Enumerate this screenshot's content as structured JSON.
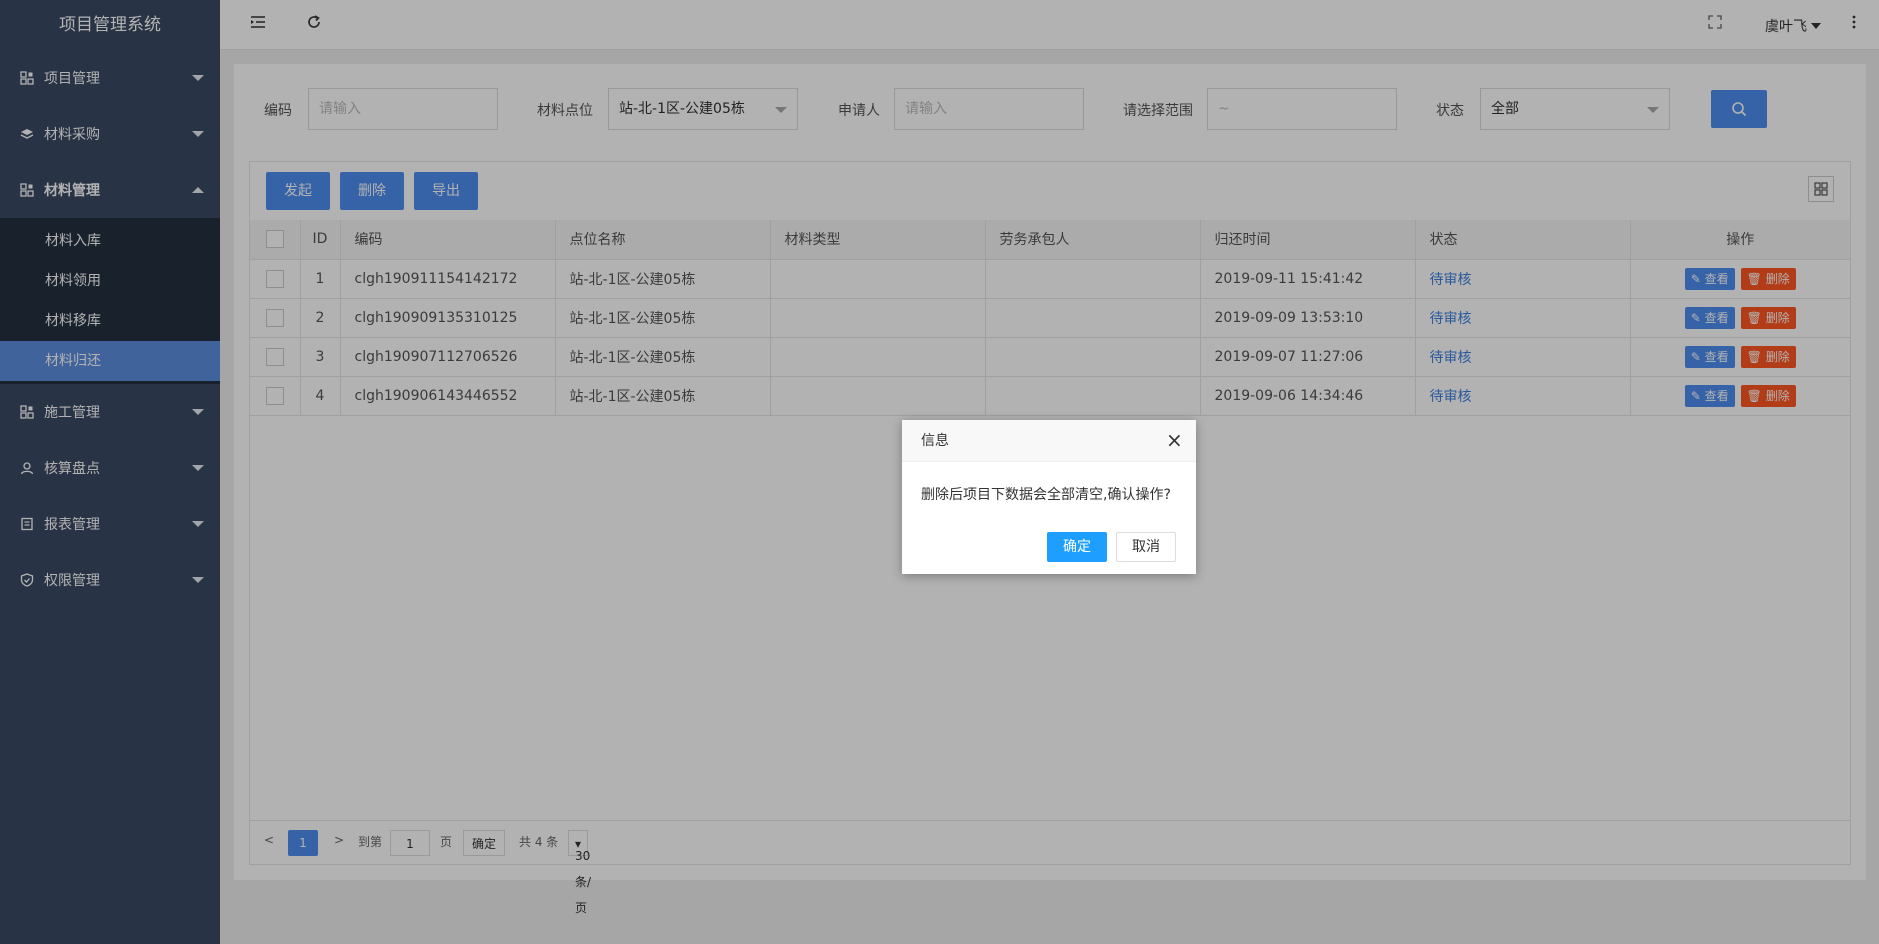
{
  "app": {
    "title": "项目管理系统"
  },
  "sidebar": {
    "items": [
      {
        "label": "项目管理",
        "icon": "apps-icon",
        "expanded": false
      },
      {
        "label": "材料采购",
        "icon": "layers-icon",
        "expanded": false
      },
      {
        "label": "材料管理",
        "icon": "apps-icon",
        "expanded": true,
        "children": [
          {
            "label": "材料入库"
          },
          {
            "label": "材料领用"
          },
          {
            "label": "材料移库"
          },
          {
            "label": "材料归还",
            "active": true
          }
        ]
      },
      {
        "label": "施工管理",
        "icon": "apps-icon",
        "expanded": false
      },
      {
        "label": "核算盘点",
        "icon": "user-icon",
        "expanded": false
      },
      {
        "label": "报表管理",
        "icon": "report-icon",
        "expanded": false
      },
      {
        "label": "权限管理",
        "icon": "shield-icon",
        "expanded": false
      }
    ]
  },
  "header": {
    "user_name": "虞叶飞"
  },
  "filters": {
    "code_label": "编码",
    "code_placeholder": "请输入",
    "location_label": "材料点位",
    "location_value": "站-北-1区-公建05栋",
    "applicant_label": "申请人",
    "applicant_placeholder": "请输入",
    "range_label": "请选择范围",
    "range_placeholder": "~",
    "status_label": "状态",
    "status_value": "全部"
  },
  "toolbar": {
    "initiate_label": "发起",
    "delete_label": "删除",
    "export_label": "导出"
  },
  "table": {
    "headers": [
      "ID",
      "编码",
      "点位名称",
      "材料类型",
      "劳务承包人",
      "归还时间",
      "状态",
      "操作"
    ],
    "rows": [
      {
        "id": "1",
        "code": "clgh190911154142172",
        "location": "站-北-1区-公建05栋",
        "material_type": "",
        "contractor": "",
        "return_time": "2019-09-11 15:41:42",
        "status": "待审核"
      },
      {
        "id": "2",
        "code": "clgh190909135310125",
        "location": "站-北-1区-公建05栋",
        "material_type": "",
        "contractor": "",
        "return_time": "2019-09-09 13:53:10",
        "status": "待审核"
      },
      {
        "id": "3",
        "code": "clgh190907112706526",
        "location": "站-北-1区-公建05栋",
        "material_type": "",
        "contractor": "",
        "return_time": "2019-09-07 11:27:06",
        "status": "待审核"
      },
      {
        "id": "4",
        "code": "clgh190906143446552",
        "location": "站-北-1区-公建05栋",
        "material_type": "",
        "contractor": "",
        "return_time": "2019-09-06 14:34:46",
        "status": "待审核"
      }
    ],
    "view_label": "查看",
    "delete_label": "删除"
  },
  "pagination": {
    "current_page": "1",
    "goto_label": "到第",
    "goto_value": "1",
    "page_unit": "页",
    "confirm_label": "确定",
    "total_label": "共 4 条",
    "page_size": "30 条/页"
  },
  "dialog": {
    "title": "信息",
    "message": "删除后项目下数据会全部清空,确认操作?",
    "ok_label": "确定",
    "cancel_label": "取消"
  },
  "colors": {
    "sidebar_bg": "#3a4a63",
    "active_item": "#5d8fe0",
    "primary_button": "#4e8ef0",
    "danger_button": "#ff5722",
    "dialog_ok": "#1e9fff"
  }
}
